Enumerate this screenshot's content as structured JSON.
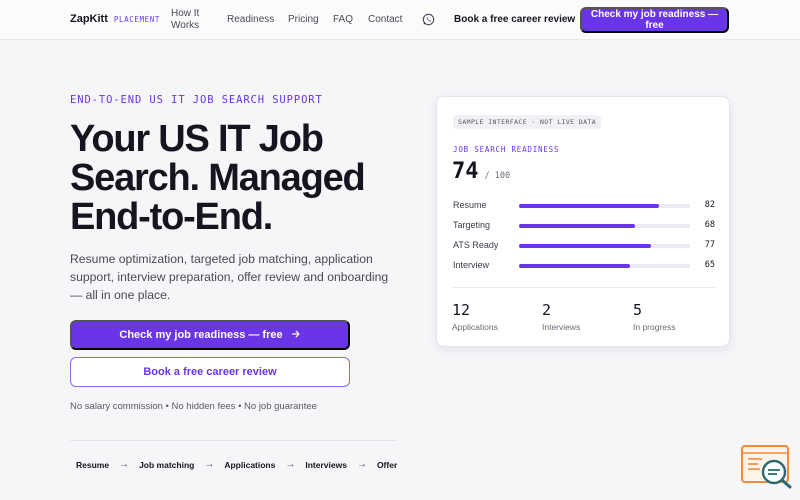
{
  "nav": {
    "logo_name": "ZapKitt",
    "logo_tag": "PLACEMENT",
    "links": [
      "How It Works",
      "Readiness",
      "Pricing",
      "FAQ",
      "Contact"
    ],
    "book_label": "Book a free career review",
    "cta_label": "Check my job readiness — free"
  },
  "hero": {
    "eyebrow": "END-TO-END US IT JOB SEARCH SUPPORT",
    "headline": "Your US IT Job Search. Managed End-to-End.",
    "subcopy": "Resume optimization, targeted job matching, application support, interview preparation, offer review and onboarding — all in one place.",
    "primary_label": "Check my job readiness — free",
    "secondary_label": "Book a free career review",
    "disclaimer": "No salary commission • No hidden fees • No job guarantee",
    "steps": [
      "Resume",
      "Job matching",
      "Applications",
      "Interviews",
      "Offer"
    ]
  },
  "card": {
    "badge": "SAMPLE INTERFACE · NOT LIVE DATA",
    "label": "JOB SEARCH READINESS",
    "score": "74",
    "score_max": "/ 100",
    "metrics": [
      {
        "label": "Resume",
        "value": "82",
        "fraction": 0.82
      },
      {
        "label": "Targeting",
        "value": "68",
        "fraction": 0.68
      },
      {
        "label": "ATS Ready",
        "value": "77",
        "fraction": 0.77
      },
      {
        "label": "Interview",
        "value": "65",
        "fraction": 0.65
      }
    ],
    "stats": [
      {
        "value": "12",
        "label": "Applications"
      },
      {
        "value": "2",
        "label": "Interviews"
      },
      {
        "value": "5",
        "label": "In progress"
      }
    ]
  },
  "colors": {
    "accent": "#6a35e6",
    "widget_orange": "#f08a3c",
    "widget_teal": "#2a6b73"
  },
  "icons": {
    "nav_contact": "whatsapp-icon",
    "primary_arrow": "arrow-right-icon",
    "step_separator": "arrow-right-icon",
    "widget": "chat-search-icon"
  }
}
